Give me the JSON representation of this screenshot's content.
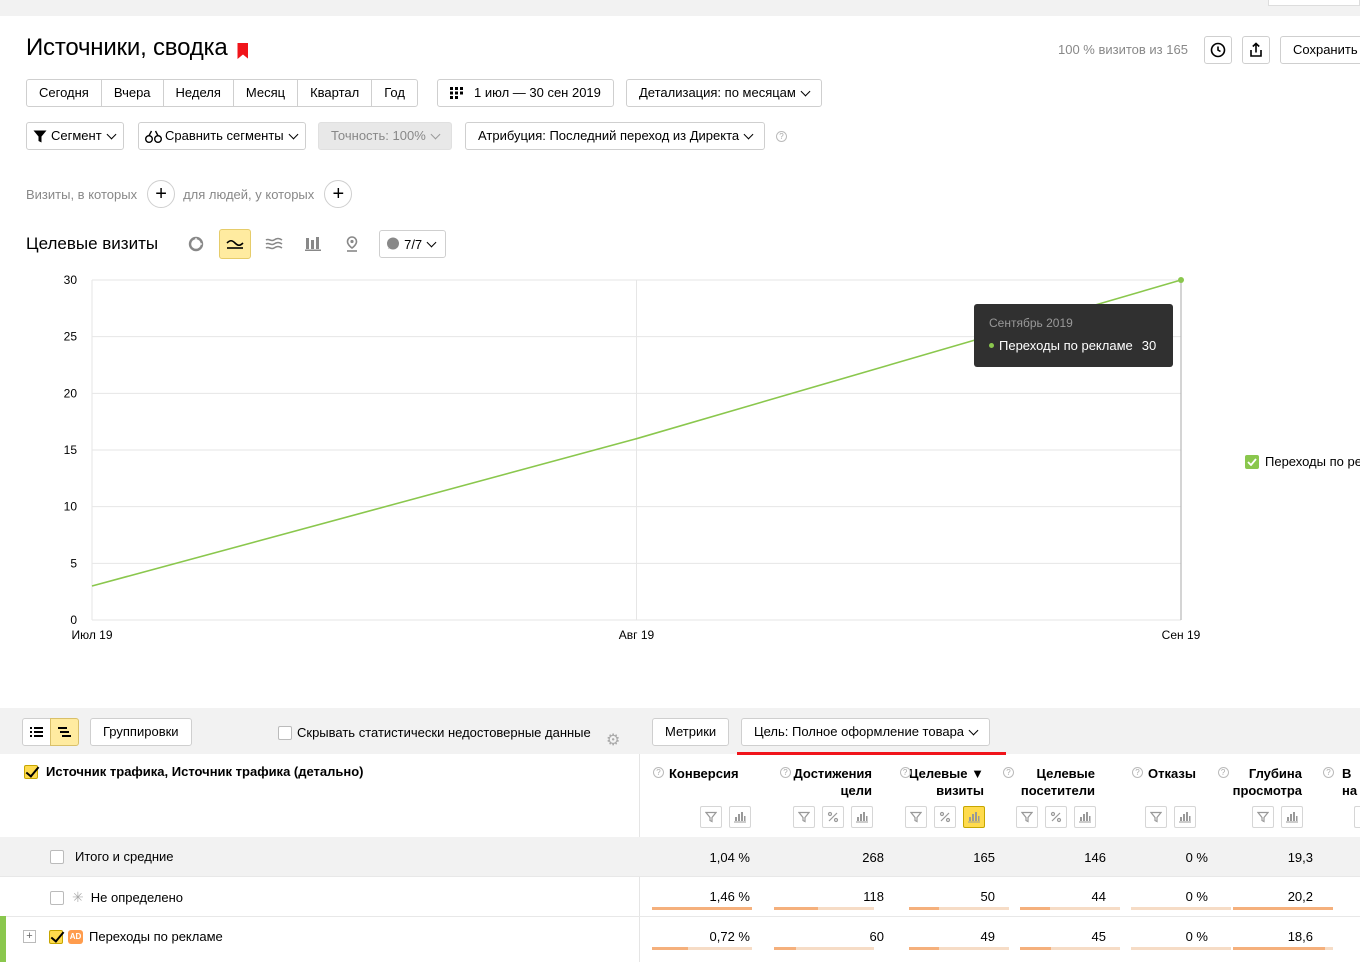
{
  "header": {
    "title": "Источники, сводка",
    "visits_info": "100 % визитов из 165",
    "save_label": "Сохранить"
  },
  "periods": [
    "Сегодня",
    "Вчера",
    "Неделя",
    "Месяц",
    "Квартал",
    "Год"
  ],
  "date_range": "1 июл — 30 сен 2019",
  "detail": "Детализация: по месяцам",
  "segment_label": "Сегмент",
  "compare_label": "Сравнить сегменты",
  "accuracy_label": "Точность: 100%",
  "attribution_label": "Атрибуция: Последний переход из Директа",
  "filter": {
    "visits_label": "Визиты, в которых",
    "people_label": "для людей, у которых"
  },
  "chart_header": {
    "title": "Целевые визиты",
    "series_count": "7/7"
  },
  "chart_data": {
    "type": "line",
    "categories": [
      "Июл 19",
      "Авг 19",
      "Сен 19"
    ],
    "series": [
      {
        "name": "Переходы по рекламе",
        "values": [
          3,
          16,
          30
        ],
        "color": "#8ac74d"
      }
    ],
    "ylim": [
      0,
      30
    ],
    "yticks": [
      0,
      5,
      10,
      15,
      20,
      25,
      30
    ],
    "grid": true
  },
  "tooltip": {
    "date": "Сентябрь 2019",
    "series": "Переходы по рекламе",
    "value": "30"
  },
  "legend": {
    "label": "Переходы по ре"
  },
  "table_toolbar": {
    "groupings_label": "Группировки",
    "hide_unreliable_label": "Скрывать статистически недостоверные данные",
    "metrics_label": "Метрики",
    "goal_label": "Цель: Полное оформление товара"
  },
  "table": {
    "dimension_header": "Источник трафика, Источник трафика (детально)",
    "columns": [
      {
        "line1": "Конверсия",
        "line2": ""
      },
      {
        "line1": "Достижения",
        "line2": "цели"
      },
      {
        "line1": "Целевые ▼",
        "line2": "визиты"
      },
      {
        "line1": "Целевые",
        "line2": "посетители"
      },
      {
        "line1": "Отказы",
        "line2": ""
      },
      {
        "line1": "Глубина",
        "line2": "просмотра"
      },
      {
        "line1": "В",
        "line2": "на"
      }
    ],
    "rows": [
      {
        "label": "Итого и средние",
        "values": [
          "1,04 %",
          "268",
          "165",
          "146",
          "0 %",
          "19,3"
        ],
        "bars": []
      },
      {
        "label": "Не определено",
        "values": [
          "1,46 %",
          "118",
          "50",
          "44",
          "0 %",
          "20,2"
        ],
        "bars": [
          1,
          0.44,
          0.3,
          0.3,
          0,
          1
        ]
      },
      {
        "label": "Переходы по рекламе",
        "values": [
          "0,72 %",
          "60",
          "49",
          "45",
          "0 %",
          "18,6"
        ],
        "bars": [
          0.36,
          0.22,
          0.3,
          0.31,
          0,
          0.92
        ]
      }
    ]
  },
  "colors": {
    "accent": "#ffdb4d",
    "series": "#8ac74d",
    "goal_underline": "#f0141a",
    "bookmark": "#f0141a"
  }
}
